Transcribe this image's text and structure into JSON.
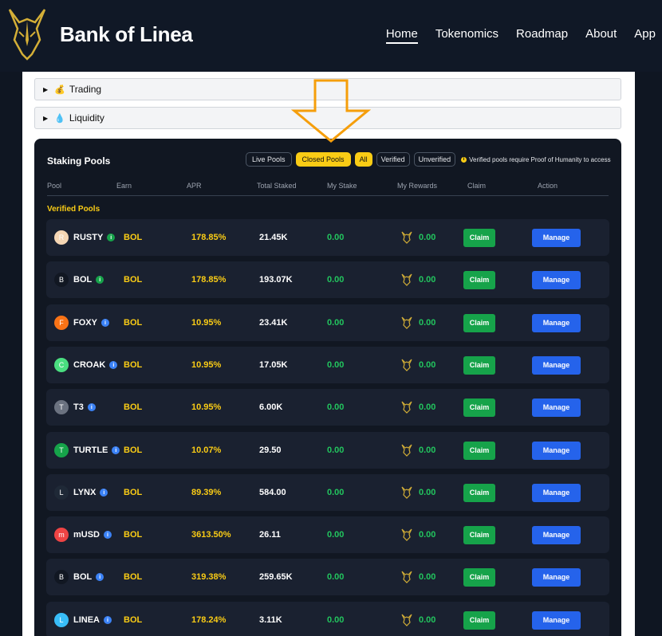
{
  "brand": {
    "name": "Bank of Linea"
  },
  "nav": [
    {
      "label": "Home",
      "active": true
    },
    {
      "label": "Tokenomics",
      "active": false
    },
    {
      "label": "Roadmap",
      "active": false
    },
    {
      "label": "About",
      "active": false
    },
    {
      "label": "App",
      "active": false
    }
  ],
  "accordions": [
    {
      "label": "Trading",
      "icon": "moneybag-icon"
    },
    {
      "label": "Liquidity",
      "icon": "droplet-icon"
    }
  ],
  "staking": {
    "title": "Staking Pools",
    "filters": {
      "live": "Live Pools",
      "closed": "Closed Pools",
      "all": "All",
      "verified": "Verified",
      "unverified": "Unverified"
    },
    "note": "Verified pools require Proof of Humanity to access",
    "columns": [
      "Pool",
      "Earn",
      "APR",
      "Total Staked",
      "My Stake",
      "My Rewards",
      "Claim",
      "Action"
    ],
    "section_label": "Verified Pools",
    "claim_label": "Claim",
    "manage_label": "Manage",
    "pools": [
      {
        "name": "RUSTY",
        "verified_color": "#16a34a",
        "icon": "rusty-icon",
        "icon_color": "#f5d6b4",
        "earn": "BOL",
        "apr": "178.85%",
        "total_staked": "21.45K",
        "my_stake": "0.00",
        "my_rewards": "0.00"
      },
      {
        "name": "BOL",
        "verified_color": "#16a34a",
        "icon": "bol-icon",
        "icon_color": "#111722",
        "earn": "BOL",
        "apr": "178.85%",
        "total_staked": "193.07K",
        "my_stake": "0.00",
        "my_rewards": "0.00"
      },
      {
        "name": "FOXY",
        "verified_color": "#3b82f6",
        "icon": "foxy-icon",
        "icon_color": "#f97316",
        "earn": "BOL",
        "apr": "10.95%",
        "total_staked": "23.41K",
        "my_stake": "0.00",
        "my_rewards": "0.00"
      },
      {
        "name": "CROAK",
        "verified_color": "#3b82f6",
        "icon": "croak-icon",
        "icon_color": "#4ade80",
        "earn": "BOL",
        "apr": "10.95%",
        "total_staked": "17.05K",
        "my_stake": "0.00",
        "my_rewards": "0.00"
      },
      {
        "name": "T3",
        "verified_color": "#3b82f6",
        "icon": "t3-icon",
        "icon_color": "#6b7280",
        "earn": "BOL",
        "apr": "10.95%",
        "total_staked": "6.00K",
        "my_stake": "0.00",
        "my_rewards": "0.00"
      },
      {
        "name": "TURTLE",
        "verified_color": "#3b82f6",
        "icon": "turtle-icon",
        "icon_color": "#16a34a",
        "earn": "BOL",
        "apr": "10.07%",
        "total_staked": "29.50",
        "my_stake": "0.00",
        "my_rewards": "0.00"
      },
      {
        "name": "LYNX",
        "verified_color": "#3b82f6",
        "icon": "lynx-icon",
        "icon_color": "#1f2937",
        "earn": "BOL",
        "apr": "89.39%",
        "total_staked": "584.00",
        "my_stake": "0.00",
        "my_rewards": "0.00"
      },
      {
        "name": "mUSD",
        "verified_color": "#3b82f6",
        "icon": "musd-icon",
        "icon_color": "#ef4444",
        "earn": "BOL",
        "apr": "3613.50%",
        "total_staked": "26.11",
        "my_stake": "0.00",
        "my_rewards": "0.00"
      },
      {
        "name": "BOL",
        "verified_color": "#3b82f6",
        "icon": "bol-icon",
        "icon_color": "#111722",
        "earn": "BOL",
        "apr": "319.38%",
        "total_staked": "259.65K",
        "my_stake": "0.00",
        "my_rewards": "0.00"
      },
      {
        "name": "LINEA",
        "verified_color": "#3b82f6",
        "icon": "linea-icon",
        "icon_color": "#38bdf8",
        "earn": "BOL",
        "apr": "178.24%",
        "total_staked": "3.11K",
        "my_stake": "0.00",
        "my_rewards": "0.00"
      }
    ]
  }
}
